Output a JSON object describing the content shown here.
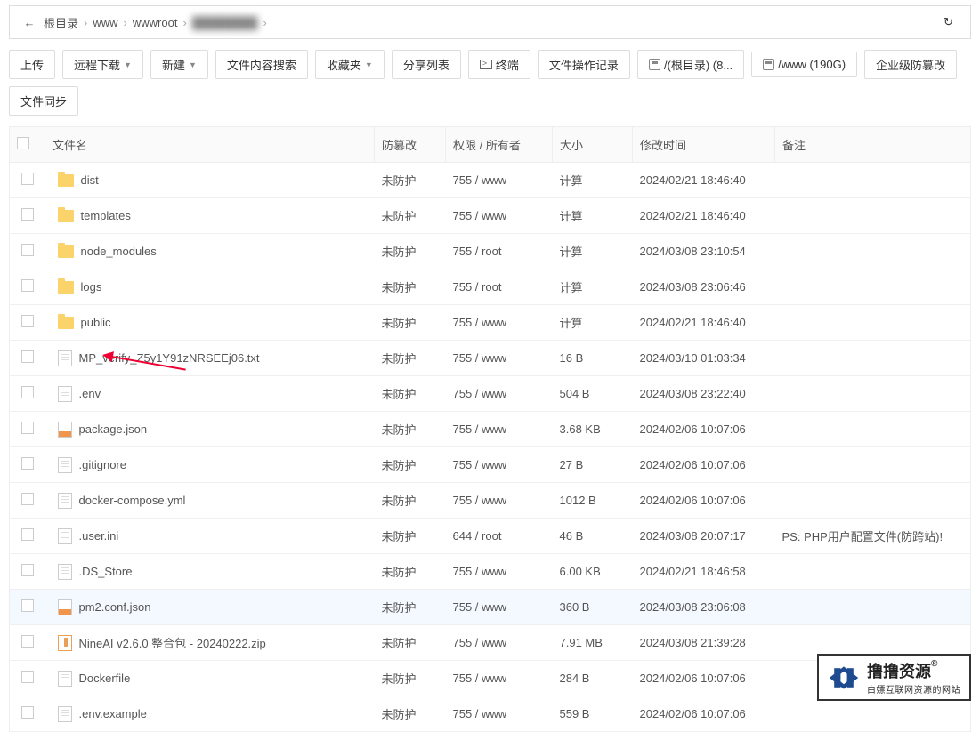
{
  "breadcrumb": {
    "back_icon": "←",
    "items": [
      "根目录",
      "www",
      "wwwroot"
    ],
    "refresh_icon": "↻"
  },
  "toolbar": {
    "upload": "上传",
    "remote_download": "远程下载",
    "new": "新建",
    "search": "文件内容搜索",
    "favorites": "收藏夹",
    "share_list": "分享列表",
    "terminal": "终端",
    "file_history": "文件操作记录",
    "disk_root": "/(根目录) (8...",
    "disk_www": "/www (190G)",
    "enterprise": "企业级防篡改",
    "sync": "文件同步"
  },
  "columns": {
    "name": "文件名",
    "protect": "防篡改",
    "perm": "权限 / 所有者",
    "size": "大小",
    "time": "修改时间",
    "note": "备注"
  },
  "rows": [
    {
      "icon": "folder",
      "name": "dist",
      "prot": "未防护",
      "perm": "755 / www",
      "size": "计算",
      "calc": true,
      "time": "2024/02/21 18:46:40",
      "note": ""
    },
    {
      "icon": "folder",
      "name": "templates",
      "prot": "未防护",
      "perm": "755 / www",
      "size": "计算",
      "calc": true,
      "time": "2024/02/21 18:46:40",
      "note": ""
    },
    {
      "icon": "folder",
      "name": "node_modules",
      "prot": "未防护",
      "perm": "755 / root",
      "size": "计算",
      "calc": true,
      "time": "2024/03/08 23:10:54",
      "note": ""
    },
    {
      "icon": "folder",
      "name": "logs",
      "prot": "未防护",
      "perm": "755 / root",
      "size": "计算",
      "calc": true,
      "time": "2024/03/08 23:06:46",
      "note": ""
    },
    {
      "icon": "folder",
      "name": "public",
      "prot": "未防护",
      "perm": "755 / www",
      "size": "计算",
      "calc": true,
      "time": "2024/02/21 18:46:40",
      "note": ""
    },
    {
      "icon": "file",
      "name": "MP_verify_Z5y1Y91zNRSEEj06.txt",
      "prot": "未防护",
      "perm": "755 / www",
      "size": "16 B",
      "calc": false,
      "time": "2024/03/10 01:03:34",
      "note": ""
    },
    {
      "icon": "file",
      "name": ".env",
      "prot": "未防护",
      "perm": "755 / www",
      "size": "504 B",
      "calc": false,
      "time": "2024/03/08 23:22:40",
      "note": ""
    },
    {
      "icon": "json",
      "name": "package.json",
      "prot": "未防护",
      "perm": "755 / www",
      "size": "3.68 KB",
      "calc": false,
      "time": "2024/02/06 10:07:06",
      "note": ""
    },
    {
      "icon": "file",
      "name": ".gitignore",
      "prot": "未防护",
      "perm": "755 / www",
      "size": "27 B",
      "calc": false,
      "time": "2024/02/06 10:07:06",
      "note": ""
    },
    {
      "icon": "file",
      "name": "docker-compose.yml",
      "prot": "未防护",
      "perm": "755 / www",
      "size": "1012 B",
      "calc": false,
      "time": "2024/02/06 10:07:06",
      "note": ""
    },
    {
      "icon": "file",
      "name": ".user.ini",
      "prot": "未防护",
      "perm": "644 / root",
      "size": "46 B",
      "calc": false,
      "time": "2024/03/08 20:07:17",
      "note": "PS: PHP用户配置文件(防跨站)!"
    },
    {
      "icon": "file",
      "name": ".DS_Store",
      "prot": "未防护",
      "perm": "755 / www",
      "size": "6.00 KB",
      "calc": false,
      "time": "2024/02/21 18:46:58",
      "note": ""
    },
    {
      "icon": "json",
      "name": "pm2.conf.json",
      "prot": "未防护",
      "perm": "755 / www",
      "size": "360 B",
      "calc": false,
      "time": "2024/03/08 23:06:08",
      "note": "",
      "hover": true
    },
    {
      "icon": "zip",
      "name": "NineAI v2.6.0 整合包 - 20240222.zip",
      "prot": "未防护",
      "perm": "755 / www",
      "size": "7.91 MB",
      "calc": false,
      "time": "2024/03/08 21:39:28",
      "note": ""
    },
    {
      "icon": "file",
      "name": "Dockerfile",
      "prot": "未防护",
      "perm": "755 / www",
      "size": "284 B",
      "calc": false,
      "time": "2024/02/06 10:07:06",
      "note": ""
    },
    {
      "icon": "file",
      "name": ".env.example",
      "prot": "未防护",
      "perm": "755 / www",
      "size": "559 B",
      "calc": false,
      "time": "2024/02/06 10:07:06",
      "note": ""
    }
  ],
  "watermark": {
    "title": "撸撸资源",
    "reg": "®",
    "sub": "白嫖互联网资源的网站"
  }
}
